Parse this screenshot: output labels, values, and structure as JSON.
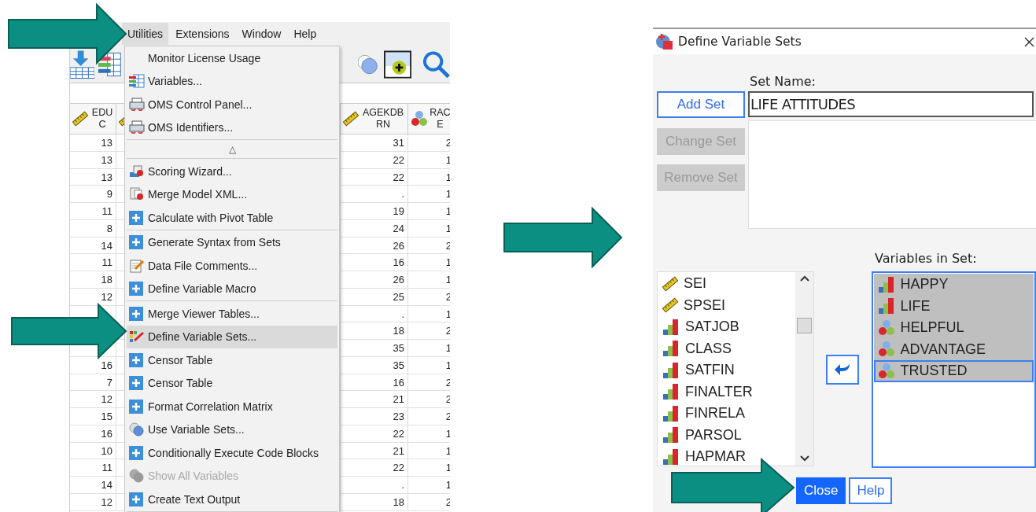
{
  "data_editor": {
    "menu_bar": [
      {
        "label": "Utilities",
        "selected": true
      },
      {
        "label": "Extensions",
        "selected": false
      },
      {
        "label": "Window",
        "selected": false
      },
      {
        "label": "Help",
        "selected": false
      }
    ],
    "columns": [
      {
        "label": "EDUC",
        "kind": "scale"
      },
      {
        "kind": "scale"
      },
      {
        "label": "AGEKDBRN",
        "kind": "scale"
      },
      {
        "label": "RACE",
        "kind": "nominal"
      }
    ],
    "rows": [
      [
        "13",
        "",
        "31",
        "2"
      ],
      [
        "13",
        "",
        "22",
        "1"
      ],
      [
        "13",
        "",
        "22",
        "1"
      ],
      [
        "9",
        "",
        ".",
        "1"
      ],
      [
        "11",
        "",
        "19",
        "1"
      ],
      [
        "8",
        "",
        "24",
        "1"
      ],
      [
        "14",
        "",
        "26",
        "2"
      ],
      [
        "11",
        "",
        "16",
        "1"
      ],
      [
        "18",
        "",
        "26",
        "1"
      ],
      [
        "12",
        "",
        "25",
        "2"
      ],
      [
        "",
        "",
        ".",
        "1"
      ],
      [
        "",
        "",
        "18",
        "2"
      ],
      [
        "",
        "",
        "35",
        "1"
      ],
      [
        "16",
        "",
        "35",
        "1"
      ],
      [
        "7",
        "",
        "16",
        "2"
      ],
      [
        "12",
        "",
        "21",
        "2"
      ],
      [
        "15",
        "",
        "23",
        "2"
      ],
      [
        "16",
        "",
        "22",
        "1"
      ],
      [
        "10",
        "",
        "21",
        "1"
      ],
      [
        "11",
        "",
        "22",
        "1"
      ],
      [
        "14",
        "",
        ".",
        "1"
      ],
      [
        "12",
        "",
        "18",
        "2"
      ]
    ],
    "menu": [
      {
        "kind": "plain",
        "label": "Monitor License Usage",
        "selected": false,
        "disabled": false
      },
      {
        "kind": "variables",
        "label": "Variables...",
        "selected": false,
        "disabled": false
      },
      {
        "kind": "oms",
        "label": "OMS Control Panel...",
        "selected": false,
        "disabled": false
      },
      {
        "kind": "oms",
        "label": "OMS Identifiers...",
        "selected": false,
        "disabled": false
      },
      {
        "kind": "separator"
      },
      {
        "kind": "scroll",
        "label": "△"
      },
      {
        "kind": "separator"
      },
      {
        "kind": "wizard",
        "label": "Scoring Wizard...",
        "selected": false,
        "disabled": false
      },
      {
        "kind": "xml",
        "label": "Merge Model XML...",
        "selected": false,
        "disabled": false
      },
      {
        "kind": "extension",
        "label": "Calculate with Pivot Table",
        "selected": false,
        "disabled": false
      },
      {
        "kind": "separator"
      },
      {
        "kind": "extension",
        "label": "Generate Syntax from Sets",
        "selected": false,
        "disabled": false
      },
      {
        "kind": "comments",
        "label": "Data File Comments...",
        "selected": false,
        "disabled": false
      },
      {
        "kind": "extension",
        "label": "Define Variable Macro",
        "selected": false,
        "disabled": false
      },
      {
        "kind": "separator"
      },
      {
        "kind": "extension",
        "label": "Merge Viewer Tables...",
        "selected": false,
        "disabled": false
      },
      {
        "kind": "sets",
        "label": "Define Variable Sets...",
        "selected": true,
        "disabled": false
      },
      {
        "kind": "extension",
        "label": "Censor Table",
        "selected": false,
        "disabled": false
      },
      {
        "kind": "extension",
        "label": "Censor Table",
        "selected": false,
        "disabled": false
      },
      {
        "kind": "extension",
        "label": "Format Correlation Matrix",
        "selected": false,
        "disabled": false
      },
      {
        "kind": "use-sets",
        "label": "Use Variable Sets...",
        "selected": false,
        "disabled": false
      },
      {
        "kind": "extension",
        "label": "Conditionally Execute Code Blocks",
        "selected": false,
        "disabled": false
      },
      {
        "kind": "use-sets",
        "label": "Show All Variables",
        "selected": false,
        "disabled": true
      },
      {
        "kind": "extension",
        "label": "Create Text Output",
        "selected": false,
        "disabled": false
      },
      {
        "kind": "separator"
      }
    ]
  },
  "dialog": {
    "title": "Define Variable Sets",
    "set_buttons": [
      {
        "label": "Add Set",
        "disabled": false,
        "focused": true
      },
      {
        "label": "Change Set",
        "disabled": true,
        "focused": false
      },
      {
        "label": "Remove Set",
        "disabled": true,
        "focused": false
      }
    ],
    "set_name": {
      "label": "Set Name:",
      "value": "LIFE ATTITUDES"
    },
    "source_variables": [
      {
        "name": "SEI",
        "kind": "scale"
      },
      {
        "name": "SPSEI",
        "kind": "scale"
      },
      {
        "name": "SATJOB",
        "kind": "ordinal"
      },
      {
        "name": "CLASS",
        "kind": "ordinal"
      },
      {
        "name": "SATFIN",
        "kind": "ordinal"
      },
      {
        "name": "FINALTER",
        "kind": "ordinal"
      },
      {
        "name": "FINRELA",
        "kind": "ordinal"
      },
      {
        "name": "PARSOL",
        "kind": "ordinal"
      },
      {
        "name": "HAPMAR",
        "kind": "ordinal"
      }
    ],
    "set_variables_label": "Variables in Set:",
    "set_variables": [
      {
        "name": "HAPPY",
        "kind": "ordinal",
        "selected": true,
        "focused": false
      },
      {
        "name": "LIFE",
        "kind": "ordinal",
        "selected": true,
        "focused": false
      },
      {
        "name": "HELPFUL",
        "kind": "nominal",
        "selected": true,
        "focused": false
      },
      {
        "name": "ADVANTAGE",
        "kind": "nominal",
        "selected": true,
        "focused": false
      },
      {
        "name": "TRUSTED",
        "kind": "nominal",
        "selected": true,
        "focused": true
      }
    ],
    "footer_buttons": [
      {
        "label": "Close",
        "default": true
      },
      {
        "label": "Help",
        "default": false
      }
    ]
  }
}
